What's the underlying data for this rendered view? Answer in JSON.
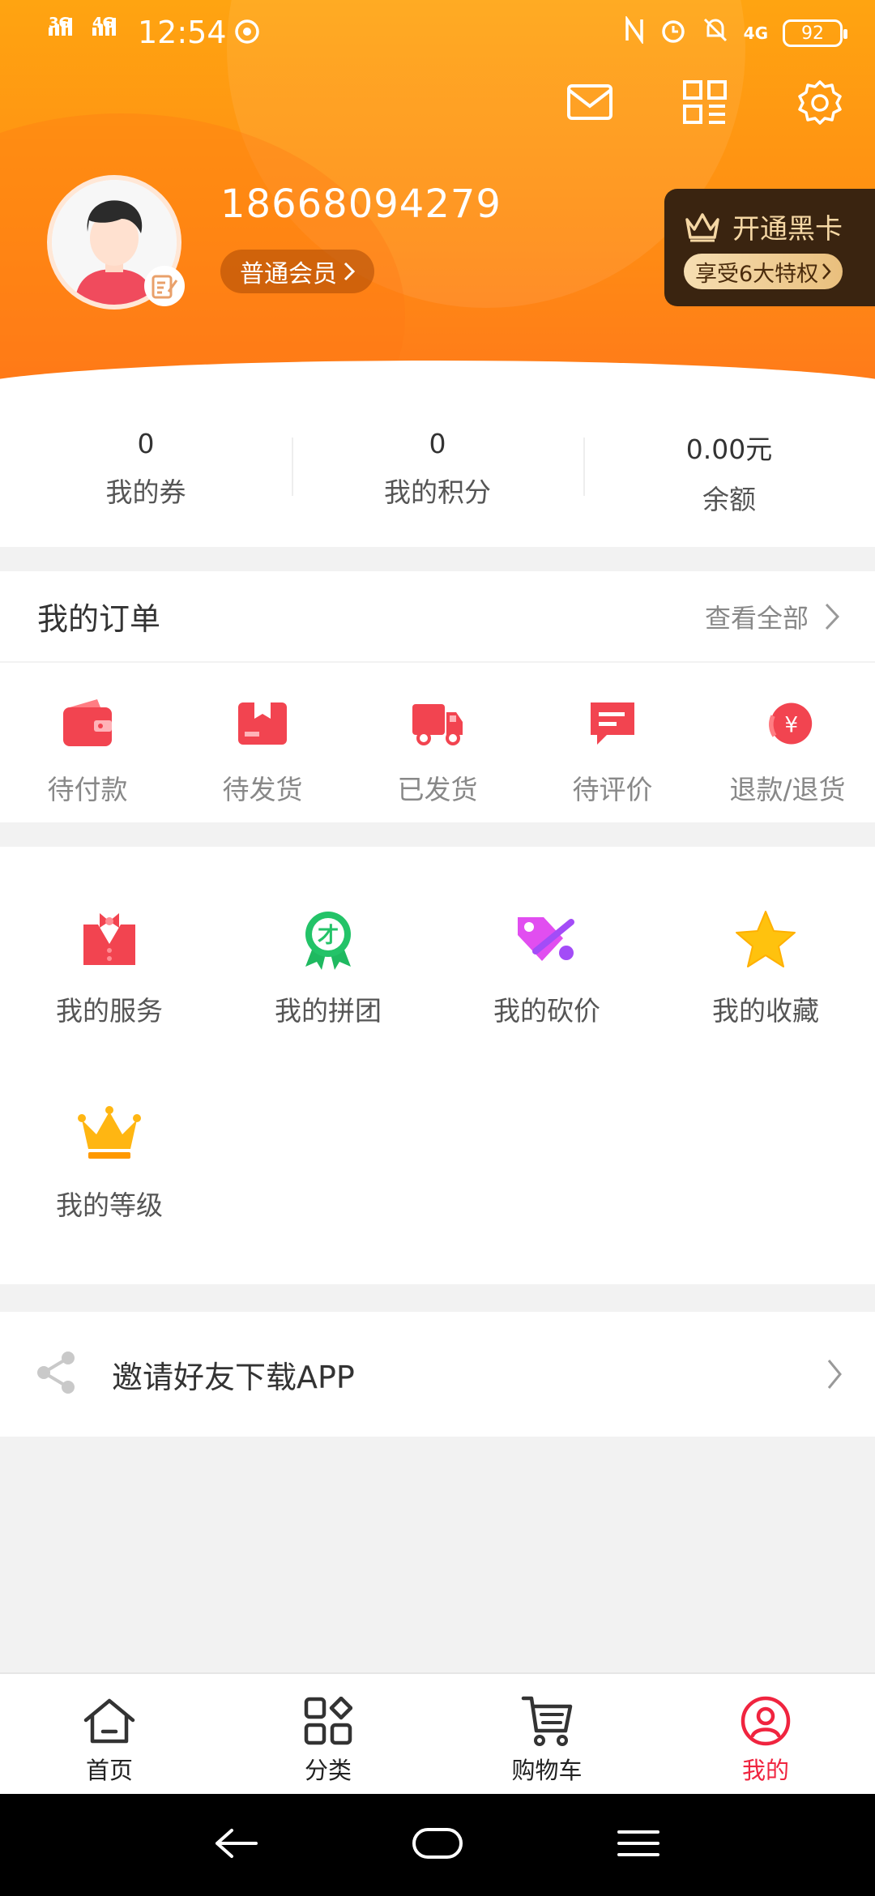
{
  "status_bar": {
    "network_1": "3G",
    "network_2": "4G",
    "time": "12:54",
    "network_3": "4G",
    "battery": "92"
  },
  "profile": {
    "username": "18668094279",
    "member_level": "普通会员",
    "black_card_title": "开通黑卡",
    "black_card_promo": "享受6大特权"
  },
  "stats": [
    {
      "value": "0",
      "label": "我的券"
    },
    {
      "value": "0",
      "label": "我的积分"
    },
    {
      "value": "0.00元",
      "label": "余额"
    }
  ],
  "orders": {
    "title": "我的订单",
    "view_all": "查看全部",
    "items": [
      {
        "label": "待付款",
        "icon": "wallet-icon"
      },
      {
        "label": "待发货",
        "icon": "package-icon"
      },
      {
        "label": "已发货",
        "icon": "truck-icon"
      },
      {
        "label": "待评价",
        "icon": "comment-icon"
      },
      {
        "label": "退款/退货",
        "icon": "refund-icon"
      }
    ]
  },
  "services": [
    {
      "label": "我的服务",
      "icon": "service-icon"
    },
    {
      "label": "我的拼团",
      "icon": "group-buy-icon"
    },
    {
      "label": "我的砍价",
      "icon": "bargain-icon"
    },
    {
      "label": "我的收藏",
      "icon": "star-icon"
    },
    {
      "label": "我的等级",
      "icon": "crown-icon"
    }
  ],
  "invite": {
    "label": "邀请好友下载APP"
  },
  "tabbar": [
    {
      "label": "首页",
      "icon": "home-icon",
      "active": false
    },
    {
      "label": "分类",
      "icon": "category-icon",
      "active": false
    },
    {
      "label": "购物车",
      "icon": "cart-icon",
      "active": false
    },
    {
      "label": "我的",
      "icon": "profile-icon",
      "active": true
    }
  ],
  "colors": {
    "accent": "#f0243f",
    "header_orange": "#ff9a14",
    "black_card_bg": "#3a2410",
    "black_card_gold": "#f5d7a4"
  }
}
